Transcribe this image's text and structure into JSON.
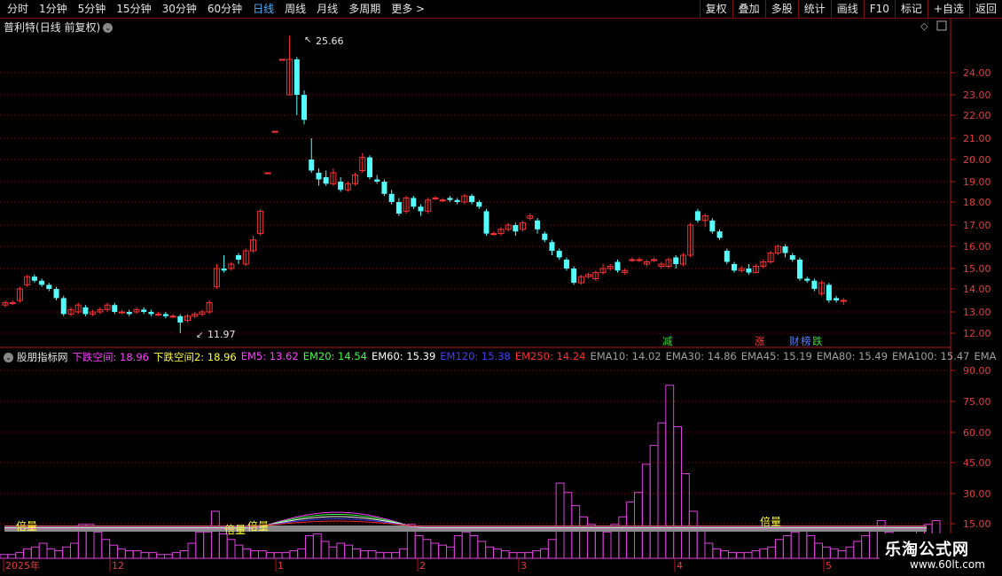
{
  "toolbar": {
    "periods": [
      {
        "label": "分时"
      },
      {
        "label": "1分钟"
      },
      {
        "label": "5分钟"
      },
      {
        "label": "15分钟"
      },
      {
        "label": "30分钟"
      },
      {
        "label": "60分钟"
      },
      {
        "label": "日线",
        "active": true
      },
      {
        "label": "周线"
      },
      {
        "label": "月线"
      },
      {
        "label": "多周期"
      },
      {
        "label": "更多 >"
      }
    ],
    "buttons": [
      "复权",
      "叠加",
      "多股",
      "统计",
      "画线",
      "F10",
      "标记",
      "+自选",
      "返回"
    ]
  },
  "stock": {
    "name": "普利特",
    "mode": "(日线 前复权)"
  },
  "colors": {
    "up": "#ff3333",
    "down": "#54fcfc",
    "grid": "#7a1010",
    "axis": "#b01818",
    "volume": "#e040e0"
  },
  "price_panel": {
    "high_label": "25.66",
    "low_label": "11.97",
    "y_ticks": [
      "24.00",
      "23.00",
      "22.00",
      "21.00",
      "20.00",
      "19.00",
      "18.00",
      "17.00",
      "16.00",
      "15.00",
      "14.00",
      "13.00",
      "12.00"
    ],
    "signals": [
      {
        "text": "减",
        "color": "#33dd33"
      },
      {
        "text": "涨",
        "color": "#ff4040"
      },
      {
        "text": "财",
        "color": "#5080ff"
      },
      {
        "text": "榜",
        "color": "#5080ff"
      },
      {
        "text": "跌",
        "color": "#33dd33"
      }
    ]
  },
  "indicator": {
    "name": "股朋指标网",
    "fields": [
      {
        "label": "下跌空间: 18.96",
        "color": "#ff40ff"
      },
      {
        "label": "下跌空间2: 18.96",
        "color": "#ffff40"
      },
      {
        "label": "EM5: 13.62",
        "color": "#ff40ff"
      },
      {
        "label": "EM20: 14.54",
        "color": "#40ff40"
      },
      {
        "label": "EM60: 15.39",
        "color": "#ffffff"
      },
      {
        "label": "EM120: 15.38",
        "color": "#4040ff"
      },
      {
        "label": "EM250: 14.24",
        "color": "#ff3030"
      },
      {
        "label": "EMA10: 14.02",
        "color": "#a0a0a0"
      },
      {
        "label": "EMA30: 14.86",
        "color": "#a0a0a0"
      },
      {
        "label": "EMA45: 15.19",
        "color": "#a0a0a0"
      },
      {
        "label": "EMA80: 15.49",
        "color": "#a0a0a0"
      },
      {
        "label": "EMA100: 15.47",
        "color": "#a0a0a0"
      },
      {
        "label": "EMA",
        "color": "#a0a0a0"
      }
    ],
    "y_ticks": [
      "90.00",
      "75.00",
      "60.00",
      "45.00",
      "30.00",
      "15.00"
    ],
    "markers": [
      "倍量",
      "倍量",
      "倍量",
      "倍量"
    ]
  },
  "date_axis": [
    "2025年",
    "12",
    "1",
    "2",
    "3",
    "4",
    "5"
  ],
  "watermark": {
    "title": "乐淘公式网",
    "url": "www.60lt.com"
  }
}
